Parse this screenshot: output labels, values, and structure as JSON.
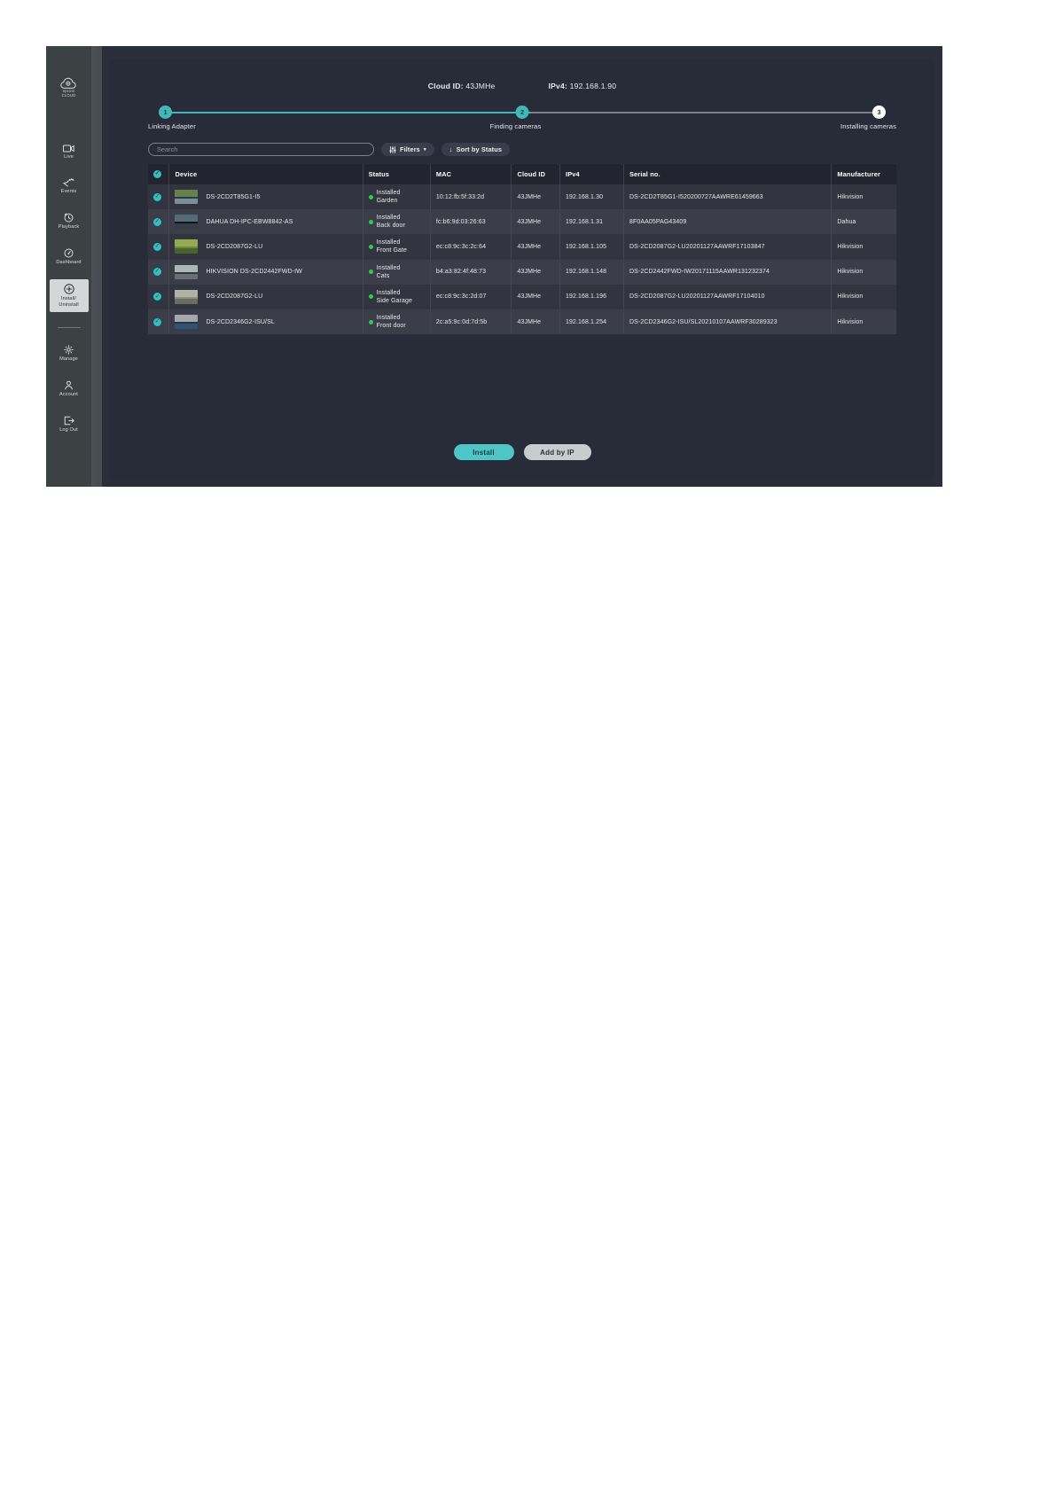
{
  "sidebar": {
    "logo": {
      "name": "epcom",
      "sub": "CLOUD"
    },
    "items": [
      {
        "id": "live",
        "label": "Live",
        "icon": "camera-icon",
        "active": false
      },
      {
        "id": "events",
        "label": "Events",
        "icon": "events-icon",
        "active": false
      },
      {
        "id": "playback",
        "label": "Playback",
        "icon": "clock-rewind-icon",
        "active": false
      },
      {
        "id": "dashboard",
        "label": "Dashboard",
        "icon": "gauge-icon",
        "active": false
      },
      {
        "id": "install-uninstall",
        "label": "Install/\nUninstall",
        "label_line1": "Install/",
        "label_line2": "Uninstall",
        "icon": "plus-circle-icon",
        "active": true
      }
    ],
    "bottom_items": [
      {
        "id": "manage",
        "label": "Manage",
        "icon": "gear-icon"
      },
      {
        "id": "account",
        "label": "Account",
        "icon": "user-icon"
      },
      {
        "id": "logout",
        "label": "Log Out",
        "icon": "logout-icon"
      }
    ]
  },
  "header": {
    "cloud_id_label": "Cloud ID:",
    "cloud_id_value": "43JMHe",
    "ipv4_label": "IPv4:",
    "ipv4_value": "192.168.1.90"
  },
  "stepper": {
    "steps": [
      {
        "number": "1",
        "label": "Linking Adapter",
        "state": "done"
      },
      {
        "number": "2",
        "label": "Finding cameras",
        "state": "current"
      },
      {
        "number": "3",
        "label": "Installing cameras",
        "state": "pending"
      }
    ],
    "accent_color": "#3fb8b8",
    "pending_color": "#7c7f8c"
  },
  "toolbar": {
    "search_placeholder": "Search",
    "search_value": "",
    "filters_label": "Filters",
    "filters_caret": "▾",
    "sort_label": "Sort by Status",
    "sort_arrow": "↓",
    "filters_icon": "sliders-icon"
  },
  "table": {
    "select_all_checked": true,
    "columns": [
      {
        "key": "check",
        "label": ""
      },
      {
        "key": "device",
        "label": "Device"
      },
      {
        "key": "status",
        "label": "Status"
      },
      {
        "key": "mac",
        "label": "MAC"
      },
      {
        "key": "cloud_id",
        "label": "Cloud ID"
      },
      {
        "key": "ipv4",
        "label": "IPv4"
      },
      {
        "key": "serial",
        "label": "Serial no."
      },
      {
        "key": "manufacturer",
        "label": "Manufacturer"
      }
    ],
    "rows": [
      {
        "checked": true,
        "device": "DS-2CD2T85G1-I5",
        "status_state": "Installed",
        "status_location": "Garden",
        "mac": "10:12:fb:5f:33:2d",
        "cloud_id": "43JMHe",
        "ipv4": "192.168.1.30",
        "serial": "DS-2CD2T85G1-I520200727AAWRE61459663",
        "manufacturer": "Hikvision",
        "thumb_colors": [
          "#2b3b4e",
          "#6e8f4a",
          "#9aa9b4"
        ]
      },
      {
        "checked": true,
        "device": "DAHUA DH-IPC-EBW8842-AS",
        "status_state": "Installed",
        "status_location": "Back door",
        "mac": "fc:b6:9d:03:26:63",
        "cloud_id": "43JMHe",
        "ipv4": "192.168.1.31",
        "serial": "8F0AA05PAG43409",
        "manufacturer": "Dahua",
        "thumb_colors": [
          "#141414",
          "#5f7a88",
          "#3c4f55"
        ]
      },
      {
        "checked": true,
        "device": "DS-2CD2087G2-LU",
        "status_state": "Installed",
        "status_location": "Front Gate",
        "mac": "ec:c8:9c:3c:2c:64",
        "cloud_id": "43JMHe",
        "ipv4": "192.168.1.105",
        "serial": "DS-2CD2087G2-LU20201127AAWRF17103847",
        "manufacturer": "Hikvision",
        "thumb_colors": [
          "#6d8a3f",
          "#9bb055",
          "#3f5626"
        ]
      },
      {
        "checked": true,
        "device": "HIKVISION DS-2CD2442FWD-IW",
        "status_state": "Installed",
        "status_location": "Cats",
        "mac": "b4:a3:82:4f:48:73",
        "cloud_id": "43JMHe",
        "ipv4": "192.168.1.148",
        "serial": "DS-2CD2442FWD-IW20171115AAWR131232374",
        "manufacturer": "Hikvision",
        "thumb_colors": [
          "#30363c",
          "#c3cbd0",
          "#7b848a"
        ]
      },
      {
        "checked": true,
        "device": "DS-2CD2087G2-LU",
        "status_state": "Installed",
        "status_location": "Side Garage",
        "mac": "ec:c8:9c:3c:2d:07",
        "cloud_id": "43JMHe",
        "ipv4": "192.168.1.196",
        "serial": "DS-2CD2087G2-LU20201127AAWRF17104010",
        "manufacturer": "Hikvision",
        "thumb_colors": [
          "#8d9083",
          "#b6b9ab",
          "#5d6154"
        ]
      },
      {
        "checked": true,
        "device": "DS-2CD2346G2-ISU/SL",
        "status_state": "Installed",
        "status_location": "Front door",
        "mac": "2c:a5:9c:0d:7d:5b",
        "cloud_id": "43JMHe",
        "ipv4": "192.168.1.254",
        "serial": "DS-2CD2346G2-ISU/SL20210107AAWRF30289323",
        "manufacturer": "Hikvision",
        "thumb_colors": [
          "#2f3338",
          "#b9bcc0",
          "#2f5f8e"
        ]
      }
    ]
  },
  "footer": {
    "install_label": "Install",
    "add_by_ip_label": "Add by IP"
  },
  "colors": {
    "accent": "#3fb8b8",
    "panel_bg": "#282b38",
    "app_bg": "#3a3f42",
    "row_odd": "#32353f",
    "row_even": "#3b3e49",
    "header_row": "#22242f",
    "status_online": "#28d04a"
  }
}
